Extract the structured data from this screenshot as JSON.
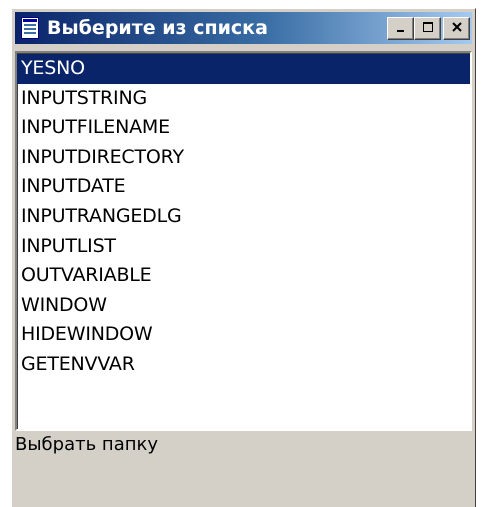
{
  "window": {
    "title": "Выберите из списка",
    "icon": "list-window-icon",
    "buttons": [
      "minimize-icon",
      "maximize-icon",
      "close-icon"
    ]
  },
  "list": {
    "selected_index": 0,
    "items": [
      "YESNO",
      "INPUTSTRING",
      "INPUTFILENAME",
      "INPUTDIRECTORY",
      "INPUTDATE",
      "INPUTRANGEDLG",
      "INPUTLIST",
      "OUTVARIABLE",
      "WINDOW",
      "HIDEWINDOW",
      "GETENVVAR"
    ]
  },
  "status": {
    "text": "Выбрать папку"
  },
  "colors": {
    "title_start": "#0a246a",
    "title_end": "#a6caf0",
    "selection": "#0a246a",
    "face": "#d4d0c8"
  }
}
